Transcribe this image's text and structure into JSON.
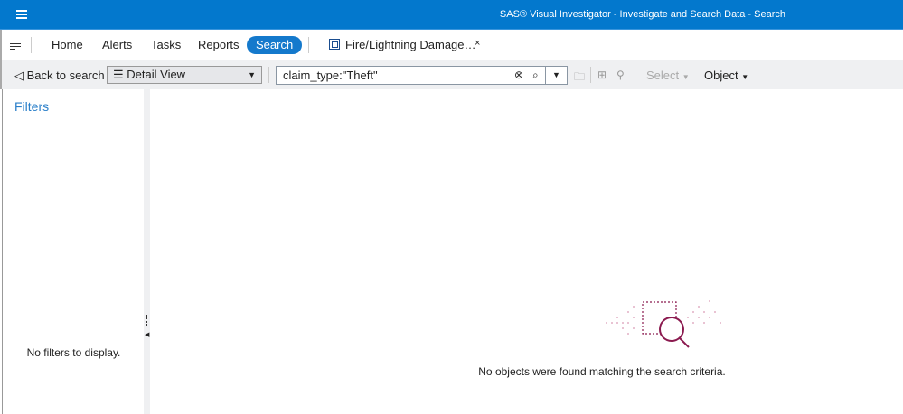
{
  "header": {
    "title": "SAS® Visual Investigator - Investigate and Search Data - Search"
  },
  "tabs": [
    {
      "label": "Home"
    },
    {
      "label": "Alerts"
    },
    {
      "label": "Tasks"
    },
    {
      "label": "Reports"
    },
    {
      "label": "Search",
      "active": true
    }
  ],
  "document_tab": {
    "label": "Fire/Lightning Damage…",
    "close": "×"
  },
  "toolbar": {
    "back_label": "Back to search",
    "view_select": "Detail View",
    "search_value": "claim_type:\"Theft\"",
    "select_label": "Select",
    "object_label": "Object"
  },
  "filters": {
    "title": "Filters",
    "empty": "No filters to display."
  },
  "results": {
    "empty": "No objects were found matching the search criteria."
  },
  "colors": {
    "brand": "#0378cd",
    "accent": "#8b1a4f"
  }
}
